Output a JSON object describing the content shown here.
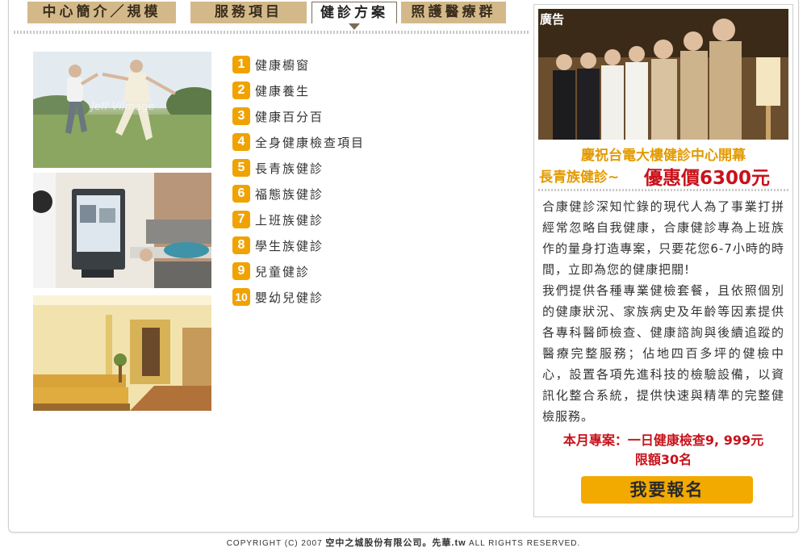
{
  "tabs": [
    {
      "label": "中心簡介／規模",
      "active": false
    },
    {
      "label": "服務項目",
      "active": false
    },
    {
      "label": "健診方案",
      "active": true
    },
    {
      "label": "照護醫療群",
      "active": false
    }
  ],
  "photos": [
    {
      "name": "elderly-couple-dancing-photo",
      "watermark": "Jeff Vilmage"
    },
    {
      "name": "medical-scan-room-photo"
    },
    {
      "name": "clinic-waiting-hallway-photo"
    }
  ],
  "plans": [
    {
      "num": "1",
      "label": "健康櫥窗"
    },
    {
      "num": "2",
      "label": "健康養生"
    },
    {
      "num": "3",
      "label": "健康百分百"
    },
    {
      "num": "4",
      "label": "全身健康檢查項目"
    },
    {
      "num": "5",
      "label": "長青族健診"
    },
    {
      "num": "6",
      "label": "福態族健診"
    },
    {
      "num": "7",
      "label": "上班族健診"
    },
    {
      "num": "8",
      "label": "學生族健診"
    },
    {
      "num": "9",
      "label": "兒童健診"
    },
    {
      "num": "10",
      "label": "嬰幼兒健診"
    }
  ],
  "ad": {
    "tag": "廣告",
    "headline": "慶祝台電大樓健診中心開幕",
    "subline": "長青族健診~",
    "price": "優惠價6300元",
    "body1": "合康健診深知忙錄的現代人為了事業打拼經常忽略自我健康，合康健診專為上班族作的量身打造專案，只要花您6-7小時的時間，立即為您的健康把關!",
    "body2": "我們提供各種專業健檢套餐，且依照個別的健康狀況、家族病史及年齡等因素提供各專科醫師檢查、健康諮詢與後續追蹤的醫療完整服務；佔地四百多坪的健檢中心，設置各項先進科技的檢驗設備，以資訊化整合系統，提供快速與精準的完整健檢服務。",
    "promo1": "本月專案：一日健康檢查9, 999元",
    "promo2": "限額30名",
    "button": "我要報名"
  },
  "footer": {
    "prefix": "COPYRIGHT (C) 2007",
    "company": "空中之城股份有限公司。先華.tw",
    "suffix": "ALL RIGHTS RESERVED."
  },
  "colors": {
    "tab_bg": "#d3b98a",
    "accent_orange": "#f0a300",
    "price_red": "#c8121b",
    "headline_orange": "#e39a00"
  }
}
